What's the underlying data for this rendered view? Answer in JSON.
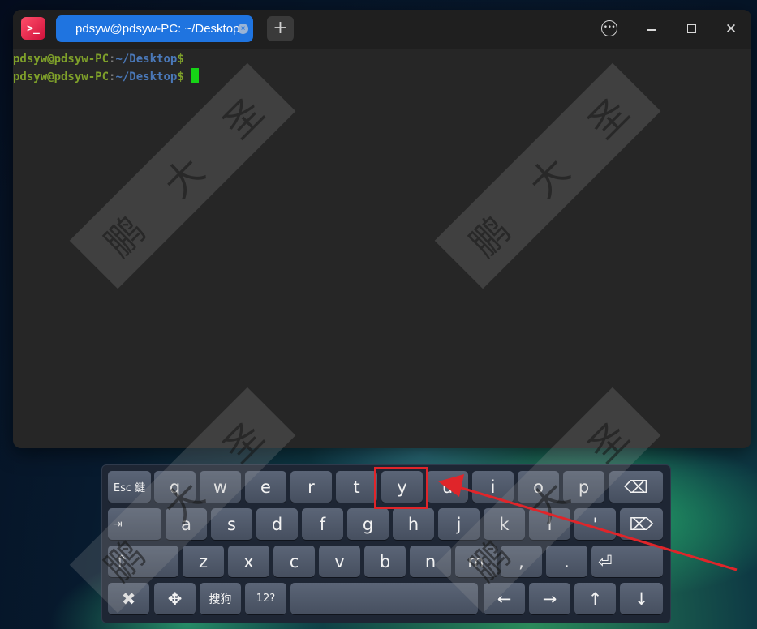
{
  "titlebar": {
    "app_icon": ">_",
    "tab_title": "pdsyw@pdsyw-PC: ~/Desktop",
    "tab_close": "×",
    "new_tab": "+",
    "menu": "•••",
    "close": "✕"
  },
  "terminal": {
    "lines": [
      {
        "user": "pdsyw@pdsyw-PC",
        "sep": ":",
        "path": "~/Desktop",
        "prompt": "$"
      },
      {
        "user": "pdsyw@pdsyw-PC",
        "sep": ":",
        "path": "~/Desktop",
        "prompt": "$"
      }
    ],
    "cursor_color": "#16d416"
  },
  "watermark": {
    "chars": [
      "鹏",
      "大",
      "圣"
    ]
  },
  "keyboard": {
    "row1": [
      "Esc 鍵",
      "q",
      "w",
      "e",
      "r",
      "t",
      "y",
      "u",
      "i",
      "o",
      "p",
      "⌫"
    ],
    "row2": [
      "⇥",
      "a",
      "s",
      "d",
      "f",
      "g",
      "h",
      "j",
      "k",
      "l",
      "'",
      "⌦"
    ],
    "row3": [
      "⇧",
      "z",
      "x",
      "c",
      "v",
      "b",
      "n",
      "m",
      ",",
      ".",
      "⏎"
    ],
    "row4": [
      "✖",
      "✥",
      "搜狗",
      "12?",
      "",
      "←",
      "→",
      "↑",
      "↓"
    ],
    "highlighted_key": "y"
  },
  "colors": {
    "accent": "#1f74e0",
    "prompt_user": "#7fa12a",
    "prompt_path": "#4a78b8",
    "annotation": "#e0252a"
  }
}
